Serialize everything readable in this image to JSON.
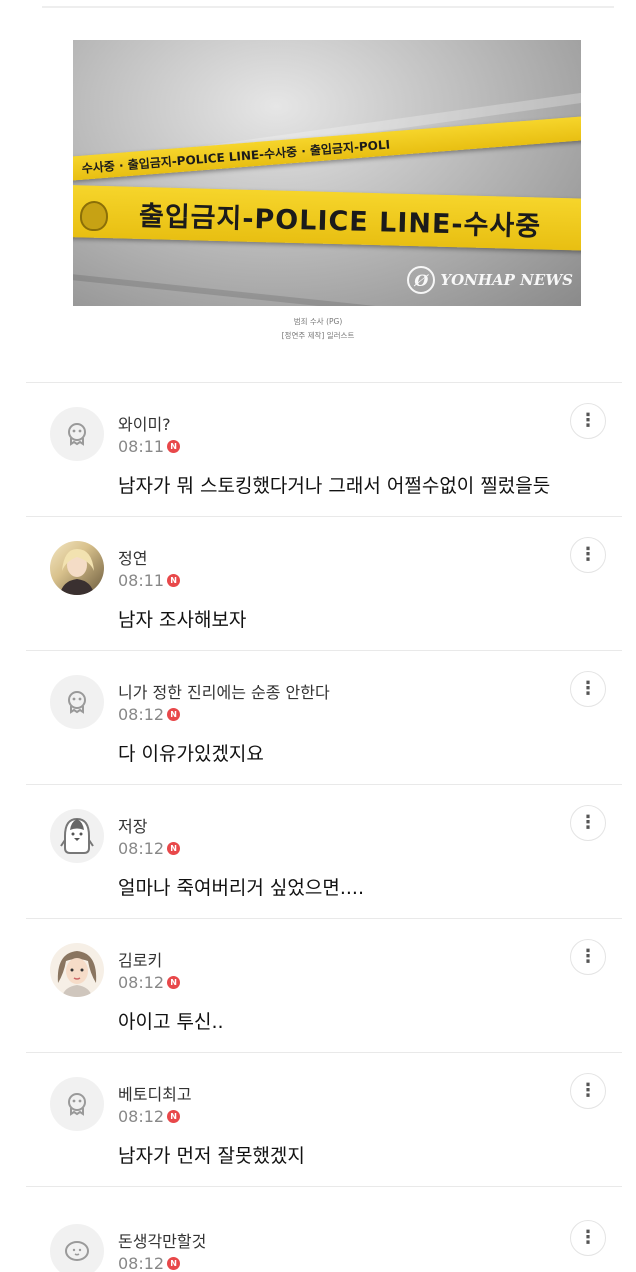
{
  "article": {
    "image_alt": "출입금지-POLICE LINE-수사중",
    "tape_back_text": "수사중 · 출입금지-POLICE LINE-수사중 · 출입금지-POLI",
    "tape_front_text": "출입금지-POLICE LINE-수사중",
    "watermark": "YONHAP NEWS",
    "caption_line1": "범죄 수사 (PG)",
    "caption_line2": "[정연주 제작] 일러스트"
  },
  "comments": [
    {
      "author": "와이미?",
      "time": "08:11",
      "badge": "N",
      "text": "남자가 뭐 스토킹했다거나 그래서 어쩔수없이 찔렀을듯",
      "avatar": "default-ghost"
    },
    {
      "author": "정연",
      "time": "08:11",
      "badge": "N",
      "text": "남자 조사해보자",
      "avatar": "photo"
    },
    {
      "author": "니가 정한 진리에는 순종 안한다",
      "time": "08:12",
      "badge": "N",
      "text": "다 이유가있겠지요",
      "avatar": "default-ghost"
    },
    {
      "author": "저장",
      "time": "08:12",
      "badge": "N",
      "text": "얼마나 죽여버리거 싶었으면....",
      "avatar": "penguin"
    },
    {
      "author": "김로키",
      "time": "08:12",
      "badge": "N",
      "text": "아이고 투신..",
      "avatar": "illustration"
    },
    {
      "author": "베토디최고",
      "time": "08:12",
      "badge": "N",
      "text": "남자가 먼저 잘못했겠지",
      "avatar": "default-ghost"
    },
    {
      "author": "돈생각만할것",
      "time": "08:12",
      "badge": "N",
      "text": "",
      "avatar": "default-smile"
    }
  ],
  "icons": {
    "more": "more-vertical-icon",
    "new": "new-badge-icon"
  },
  "colors": {
    "accent": "#e8484a",
    "tape": "#f2cf22"
  }
}
